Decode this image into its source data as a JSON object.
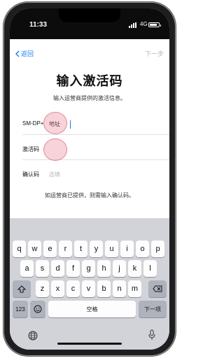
{
  "status_bar": {
    "time": "11:33",
    "network": "4G"
  },
  "nav": {
    "back_label": "返回",
    "next_label": "下一步"
  },
  "page": {
    "title": "输入激活码",
    "subtitle": "输入运营商提供的激活信息。",
    "hint": "如运营商已提供，则需输入确认码。"
  },
  "fields": [
    {
      "label": "SM-DP+",
      "value": "地址",
      "placeholder": ""
    },
    {
      "label": "激活码",
      "value": "",
      "placeholder": ""
    },
    {
      "label": "确认码",
      "value": "",
      "placeholder": "选填"
    }
  ],
  "keyboard": {
    "row1": [
      "q",
      "w",
      "e",
      "r",
      "t",
      "y",
      "u",
      "i",
      "o",
      "p"
    ],
    "row2": [
      "a",
      "s",
      "d",
      "f",
      "g",
      "h",
      "j",
      "k",
      "l"
    ],
    "row3": [
      "z",
      "x",
      "c",
      "v",
      "b",
      "n",
      "m"
    ],
    "numbers_label": "123",
    "space_label": "空格",
    "next_label": "下一项",
    "icons": {
      "shift": "shift-icon",
      "delete": "backspace-icon",
      "emoji": "emoji-icon",
      "globe": "globe-icon",
      "mic": "microphone-icon"
    }
  },
  "colors": {
    "accent": "#1a7cf5",
    "disabled": "#b9b9c0",
    "keyboard_bg": "#d1d3d9"
  }
}
